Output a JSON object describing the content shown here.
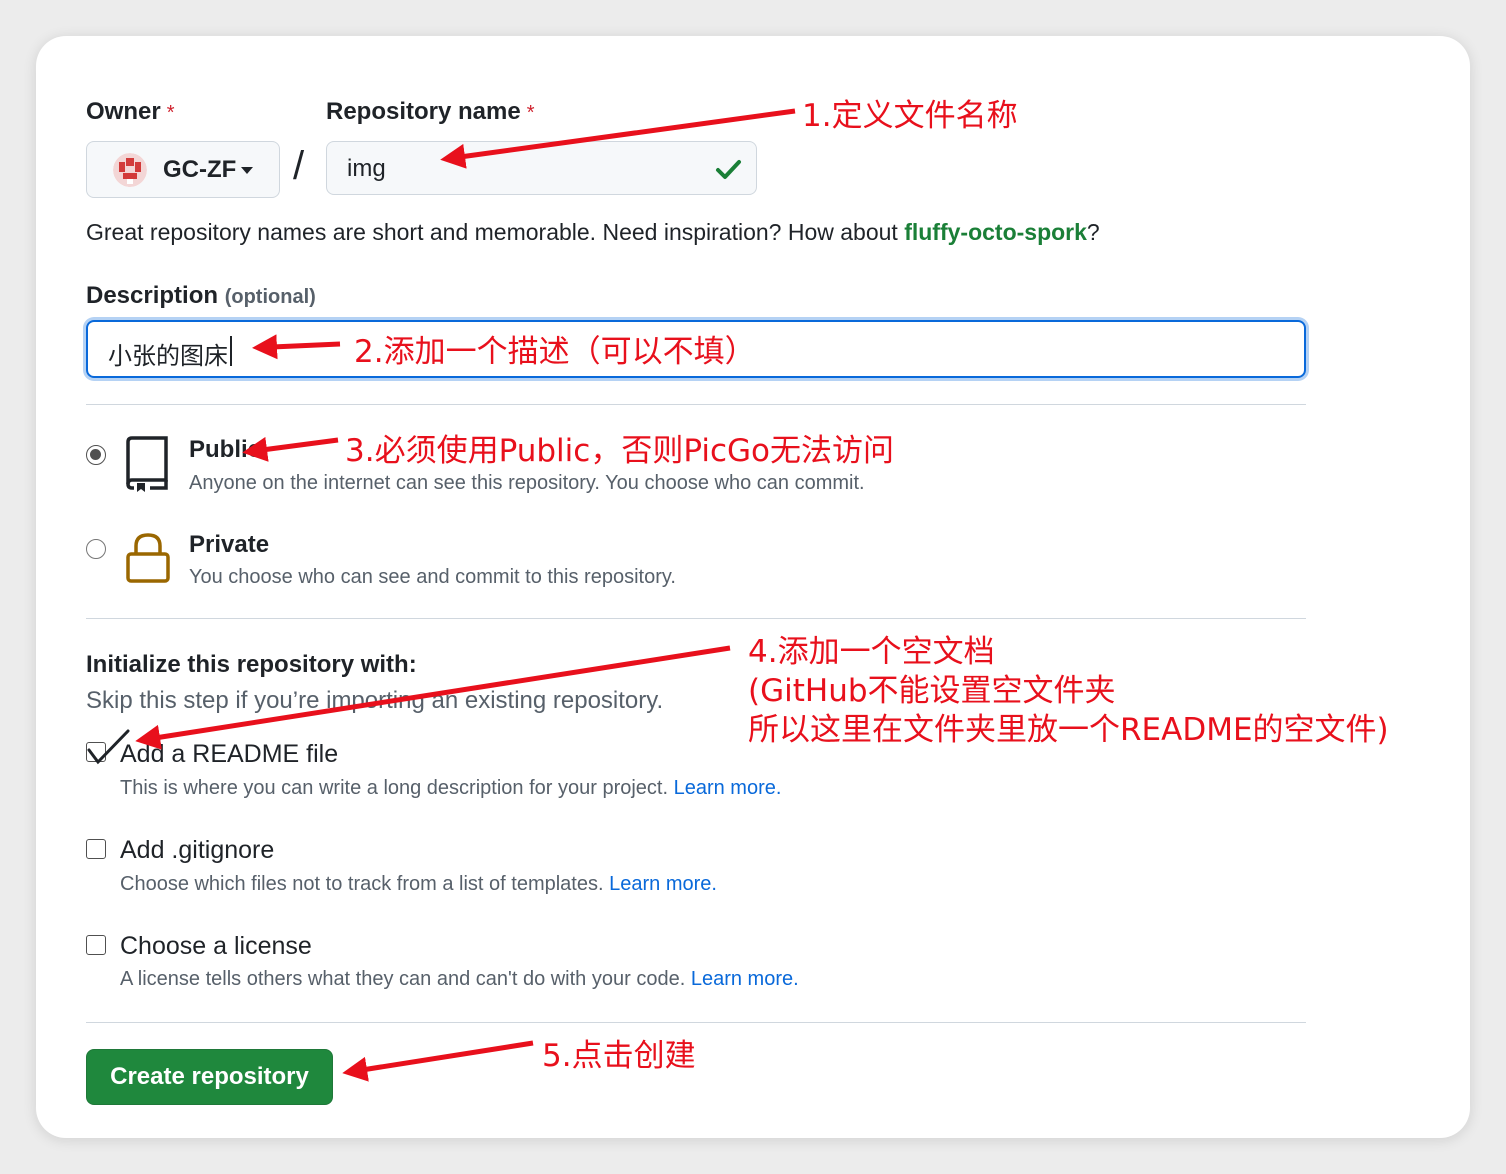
{
  "owner": {
    "label": "Owner",
    "required_mark": "*",
    "selected": "GC-ZF"
  },
  "separator": "/",
  "repo_name": {
    "label": "Repository name",
    "required_mark": "*",
    "value": "img"
  },
  "hint": {
    "prefix": "Great repository names are short and memorable. Need inspiration? How about ",
    "suggestion": "fluffy-octo-spork",
    "suffix": "?"
  },
  "description": {
    "label": "Description",
    "optional": "(optional)",
    "value": "小张的图床"
  },
  "visibility": {
    "public": {
      "title": "Public",
      "desc": "Anyone on the internet can see this repository. You choose who can commit.",
      "selected": true
    },
    "private": {
      "title": "Private",
      "desc": "You choose who can see and commit to this repository.",
      "selected": false
    }
  },
  "initialize": {
    "title": "Initialize this repository with:",
    "subtitle": "Skip this step if you’re importing an existing repository.",
    "readme": {
      "title": "Add a README file",
      "desc": "This is where you can write a long description for your project.",
      "link": "Learn more.",
      "checked": true
    },
    "gitignore": {
      "title": "Add .gitignore",
      "desc": "Choose which files not to track from a list of templates.",
      "link": "Learn more.",
      "checked": false
    },
    "license": {
      "title": "Choose a license",
      "desc": "A license tells others what they can and can't do with your code.",
      "link": "Learn more.",
      "checked": false
    }
  },
  "create_button": "Create repository",
  "annotations": {
    "a1": "1.定义文件名称",
    "a2": "2.添加一个描述（可以不填）",
    "a3": "3.必须使用Public，否则PicGo无法访问",
    "a4_line1": "4.添加一个空文档",
    "a4_line2": "(GitHub不能设置空文件夹",
    "a4_line3": "所以这里在文件夹里放一个README的空文件)",
    "a5": "5.点击创建"
  },
  "colors": {
    "accent_green": "#1f883d",
    "link_blue": "#0969da",
    "annotation_red": "#e8101c",
    "suggestion_green": "#1a7f37"
  },
  "icons": {
    "public": "repo-icon",
    "private": "lock-icon",
    "valid": "check-icon"
  }
}
